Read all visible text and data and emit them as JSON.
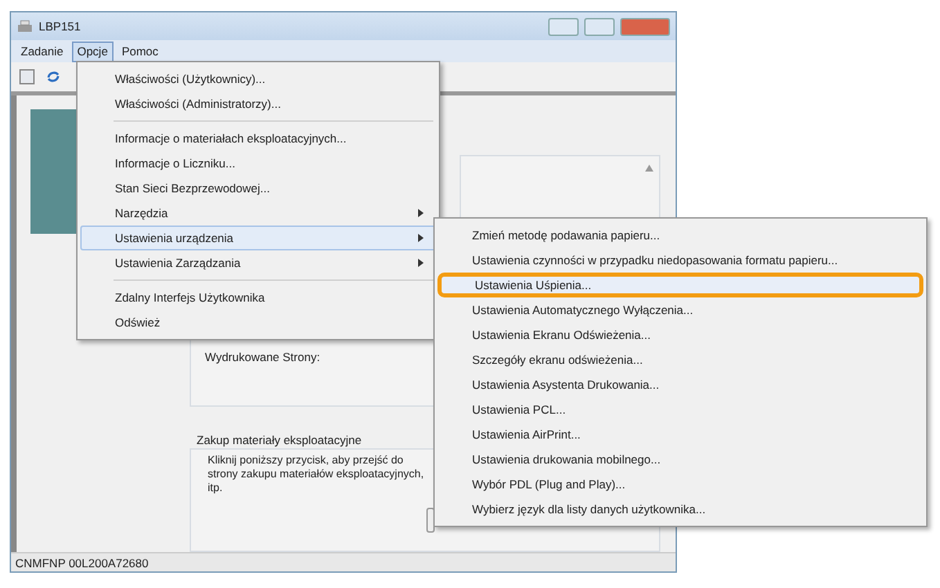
{
  "window": {
    "title": "LBP151"
  },
  "menubar": [
    {
      "label": "Zadanie",
      "selected": false
    },
    {
      "label": "Opcje",
      "selected": true
    },
    {
      "label": "Pomoc",
      "selected": false
    }
  ],
  "options_menu": {
    "sections": [
      {
        "items": [
          {
            "label": "Właściwości (Użytkownicy)...",
            "submenu": false,
            "selected": false
          },
          {
            "label": "Właściwości (Administratorzy)...",
            "submenu": false,
            "selected": false
          }
        ]
      },
      {
        "items": [
          {
            "label": "Informacje o materiałach eksploatacyjnych...",
            "submenu": false,
            "selected": false
          },
          {
            "label": "Informacje o Liczniku...",
            "submenu": false,
            "selected": false
          },
          {
            "label": "Stan Sieci Bezprzewodowej...",
            "submenu": false,
            "selected": false
          },
          {
            "label": "Narzędzia",
            "submenu": true,
            "selected": false
          },
          {
            "label": "Ustawienia urządzenia",
            "submenu": true,
            "selected": true
          },
          {
            "label": "Ustawienia Zarządzania",
            "submenu": true,
            "selected": false
          }
        ]
      },
      {
        "items": [
          {
            "label": "Zdalny Interfejs Użytkownika",
            "submenu": false,
            "selected": false
          },
          {
            "label": "Odśwież",
            "submenu": false,
            "selected": false
          }
        ]
      }
    ]
  },
  "device_submenu": {
    "items": [
      {
        "label": "Zmień metodę podawania papieru...",
        "highlighted": false
      },
      {
        "label": "Ustawienia czynności w przypadku niedopasowania formatu papieru...",
        "highlighted": false
      },
      {
        "label": "Ustawienia Uśpienia...",
        "highlighted": true
      },
      {
        "label": "Ustawienia Automatycznego Wyłączenia...",
        "highlighted": false
      },
      {
        "label": "Ustawienia Ekranu Odświeżenia...",
        "highlighted": false
      },
      {
        "label": "Szczegóły ekranu odświeżenia...",
        "highlighted": false
      },
      {
        "label": "Ustawienia Asystenta Drukowania...",
        "highlighted": false
      },
      {
        "label": "Ustawienia PCL...",
        "highlighted": false
      },
      {
        "label": "Ustawienia AirPrint...",
        "highlighted": false
      },
      {
        "label": "Ustawienia drukowania mobilnego...",
        "highlighted": false
      },
      {
        "label": "Wybór PDL (Plug and Play)...",
        "highlighted": false
      },
      {
        "label": "Wybierz język dla listy danych użytkownika...",
        "highlighted": false
      }
    ]
  },
  "printed_pages_label": "Wydrukowane Strony:",
  "supplies_group": {
    "title": "Zakup materiały eksploatacyjne",
    "text": "Kliknij poniższy przycisk, aby przejść do strony zakupu materiałów eksploatacyjnych, itp."
  },
  "status_bar": "CNMFNP 00L200A72680"
}
